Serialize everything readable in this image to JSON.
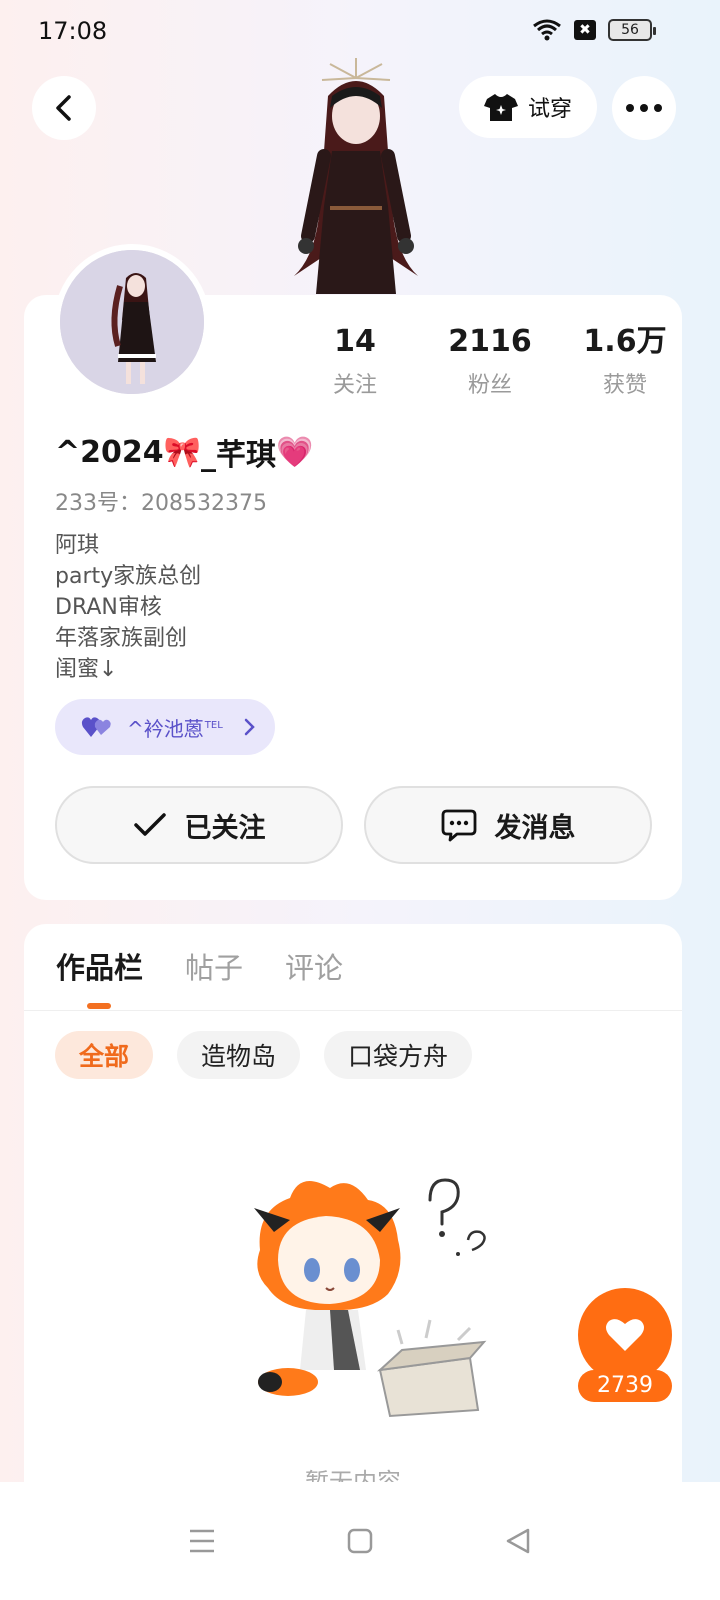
{
  "status_bar": {
    "time": "17:08",
    "battery": "56",
    "wifi_icon": "wifi-icon",
    "xbox_icon": "✖"
  },
  "header": {
    "tryon_label": "试穿"
  },
  "profile": {
    "stats": [
      {
        "value": "14",
        "label": "关注"
      },
      {
        "value": "2116",
        "label": "粉丝"
      },
      {
        "value": "1.6万",
        "label": "获赞"
      }
    ],
    "name_prefix": "^2024",
    "name_ribbon": "🎀",
    "name_mid": "_芊琪",
    "name_heart": "💗",
    "uid": "233号：208532375",
    "bio": [
      "阿琪",
      "party家族总创",
      "DRAN审核",
      "年落家族副创",
      "闺蜜↓"
    ],
    "partner_name": "^衿池蒽",
    "partner_tm": "TEL",
    "follow_label": "已关注",
    "message_label": "发消息"
  },
  "works": {
    "tabs": [
      {
        "label": "作品栏",
        "active": true
      },
      {
        "label": "帖子",
        "active": false
      },
      {
        "label": "评论",
        "active": false
      }
    ],
    "filters": [
      {
        "label": "全部",
        "active": true
      },
      {
        "label": "造物岛",
        "active": false
      },
      {
        "label": "口袋方舟",
        "active": false
      }
    ],
    "empty_text": "暂无内容"
  },
  "like": {
    "count": "2739"
  },
  "colors": {
    "accent": "#ff6d12",
    "partner": "#5a51c9"
  }
}
